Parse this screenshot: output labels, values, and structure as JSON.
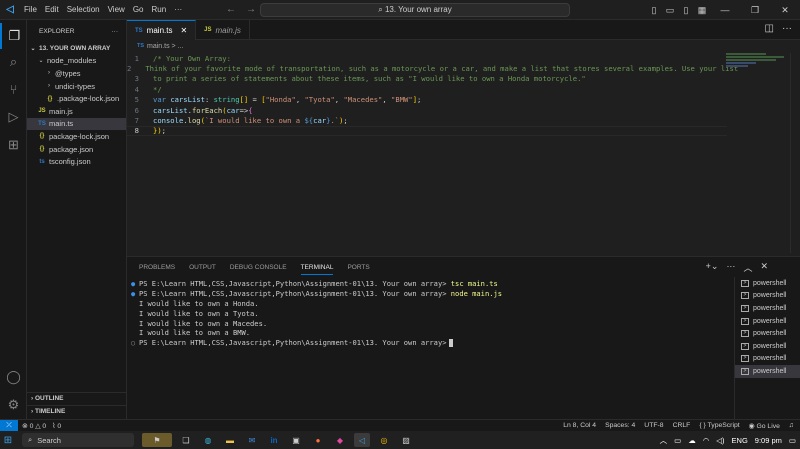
{
  "titlebar": {
    "menu": [
      "File",
      "Edit",
      "Selection",
      "View",
      "Go",
      "Run",
      "···"
    ],
    "command_center": "13. Your own array"
  },
  "explorer": {
    "header": "EXPLORER",
    "root": "13. YOUR OWN ARRAY",
    "tree": [
      {
        "name": "node_modules",
        "type": "folder-open",
        "indent": 1
      },
      {
        "name": "@types",
        "type": "folder",
        "indent": 2
      },
      {
        "name": "undici-types",
        "type": "folder",
        "indent": 2
      },
      {
        "name": ".package-lock.json",
        "type": "json",
        "indent": 2
      },
      {
        "name": "main.js",
        "type": "js",
        "indent": 1
      },
      {
        "name": "main.ts",
        "type": "ts",
        "indent": 1
      },
      {
        "name": "package-lock.json",
        "type": "json",
        "indent": 1
      },
      {
        "name": "package.json",
        "type": "json",
        "indent": 1
      },
      {
        "name": "tsconfig.json",
        "type": "tsjson",
        "indent": 1
      }
    ],
    "outline": "OUTLINE",
    "timeline": "TIMELINE"
  },
  "editor": {
    "tabs": [
      {
        "label": "main.ts",
        "icon": "TS",
        "active": true
      },
      {
        "label": "main.js",
        "icon": "JS",
        "active": false
      }
    ],
    "breadcrumb": "main.ts > ...",
    "lines": [
      "/* Your Own Array:",
      "Think of your favorite mode of transportation, such as a motorcycle or a car, and make a list that stores several examples. Use your list",
      "to print a series of statements about these items, such as \"I would like to own a Honda motorcycle.\"",
      "*/",
      "var carsList: string[] = [\"Honda\", \"Tyota\", \"Macedes\", \"BMW\"];",
      "carsList.forEach(car=>{",
      "console.log(`I would like to own a ${car}.`);",
      "});"
    ]
  },
  "panel": {
    "tabs": [
      "PROBLEMS",
      "OUTPUT",
      "DEBUG CONSOLE",
      "TERMINAL",
      "PORTS"
    ],
    "active_tab": "TERMINAL",
    "prompt": "PS E:\\Learn HTML,CSS,Javascript,Python\\Assignment-01\\13. Your own array>",
    "cmd1": "tsc main.ts",
    "cmd2": "node main.js",
    "output": [
      "I would like to own a Honda.",
      "I would like to own a Tyota.",
      "I would like to own a Macedes.",
      "I would like to own a BMW."
    ],
    "terminals": [
      "powershell",
      "powershell",
      "powershell",
      "powershell",
      "powershell",
      "powershell",
      "powershell",
      "powershell"
    ]
  },
  "statusbar": {
    "errors": "0",
    "warnings": "0",
    "ports": "0",
    "position": "Ln 8, Col 4",
    "spaces": "Spaces: 4",
    "encoding": "UTF-8",
    "eol": "CRLF",
    "language": "TypeScript",
    "golive": "Go Live"
  },
  "taskbar": {
    "search": "Search",
    "lang": "ENG",
    "time": "9:09 pm"
  }
}
